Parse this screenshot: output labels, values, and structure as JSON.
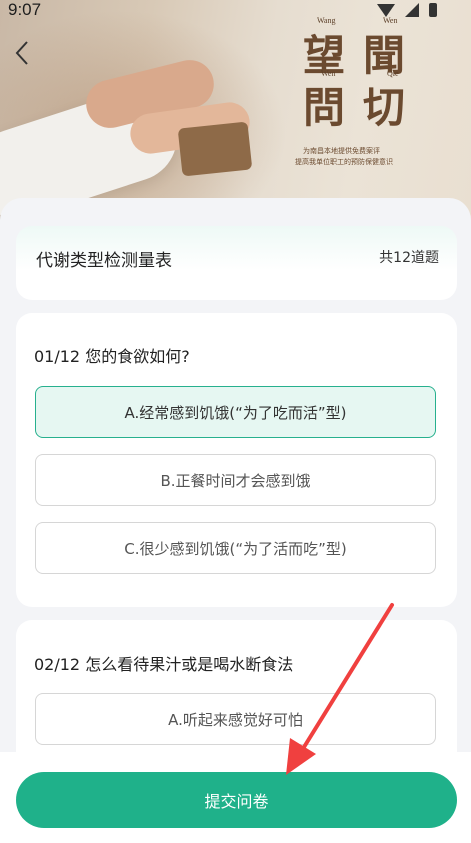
{
  "status": {
    "time": "9:07"
  },
  "header": {
    "back_glyph": "‹",
    "calligraphy": {
      "wang": "望",
      "wen2": "聞",
      "wen": "問",
      "qie": "切",
      "wang_pinyin": "Wang",
      "wen2_pinyin": "Wen",
      "wen_pinyin": "Wen",
      "qie_pinyin": "Qie",
      "tagline1": "为南昌本地提供免费案评",
      "tagline2": "提高我单位职工的预防保健意识"
    }
  },
  "survey": {
    "title": "代谢类型检测量表",
    "count": "共12道题"
  },
  "questions": [
    {
      "title": "01/12 您的食欲如何?",
      "options": [
        {
          "label": "A.经常感到饥饿(“为了吃而活”型)",
          "selected": true
        },
        {
          "label": "B.正餐时间才会感到饿",
          "selected": false
        },
        {
          "label": "C.很少感到饥饿(“为了活而吃”型)",
          "selected": false
        }
      ]
    },
    {
      "title": "02/12 怎么看待果汁或是喝水断食法",
      "options": [
        {
          "label": "A.听起来感觉好可怕",
          "selected": false
        }
      ]
    }
  ],
  "footer": {
    "submit_label": "提交问卷"
  },
  "colors": {
    "accent": "#1fb18a",
    "selected_bg": "#e6f7f2",
    "annotation": "#f0403f"
  }
}
